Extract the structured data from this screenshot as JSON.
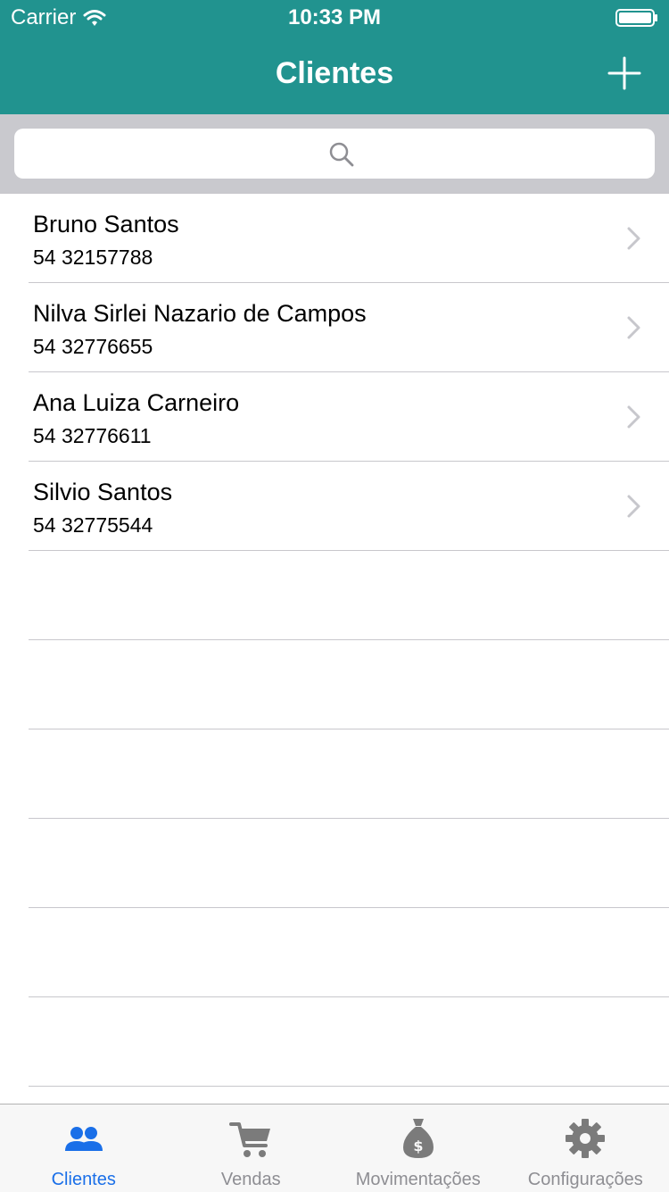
{
  "status_bar": {
    "carrier": "Carrier",
    "time": "10:33 PM",
    "icons": [
      "wifi-icon",
      "battery-icon"
    ]
  },
  "nav": {
    "title": "Clientes",
    "add_icon": "plus-icon"
  },
  "search": {
    "placeholder": "",
    "icon": "search-icon"
  },
  "clients": [
    {
      "name": "Bruno Santos",
      "phone": "54 32157788"
    },
    {
      "name": "Nilva Sirlei Nazario de Campos",
      "phone": "54 32776655"
    },
    {
      "name": "Ana Luiza Carneiro",
      "phone": "54 32776611"
    },
    {
      "name": "Silvio Santos",
      "phone": "54 32775544"
    }
  ],
  "tabs": [
    {
      "label": "Clientes",
      "icon": "people-icon",
      "active": true
    },
    {
      "label": "Vendas",
      "icon": "cart-icon",
      "active": false
    },
    {
      "label": "Movimentações",
      "icon": "money-bag-icon",
      "active": false
    },
    {
      "label": "Configurações",
      "icon": "gear-icon",
      "active": false
    }
  ],
  "colors": {
    "header": "#21938f",
    "search_background": "#c9c9ce",
    "active_tab": "#1a6fe8",
    "inactive_tab": "#8e8e93"
  }
}
